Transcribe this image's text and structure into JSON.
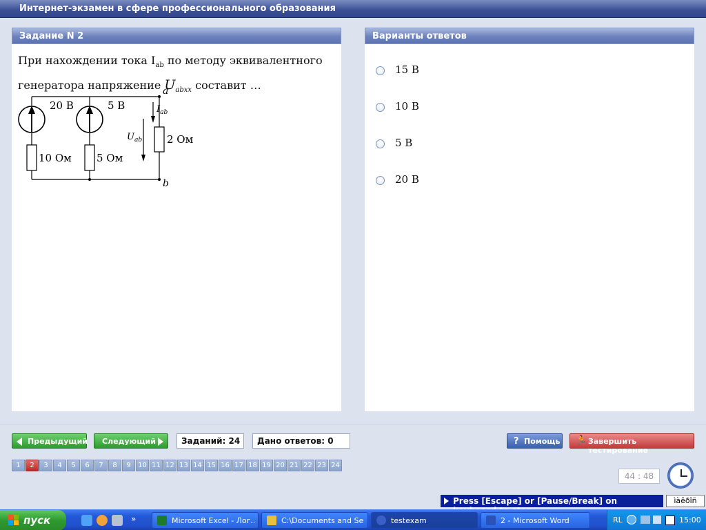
{
  "app": {
    "title": "Интернет-экзамен в сфере профессионального образования"
  },
  "question": {
    "header": "Задание N 2",
    "text_a": "При нахождении тока I",
    "text_sub": "ab",
    "text_b": " по методу эквивалентного",
    "text_c": "генератора напряжение ",
    "text_var": "U",
    "text_var_sub": "abxx",
    "text_d": " составит …",
    "circuit": {
      "src1": "20 В",
      "src2": "5 В",
      "r1": "10 Ом",
      "r2": "5 Ом",
      "r3": "2 Ом",
      "node_a": "a",
      "node_b": "b",
      "i_label": "I",
      "i_sub": "ab",
      "u_label": "U",
      "u_sub": "ab"
    }
  },
  "answers": {
    "header": "Варианты ответов",
    "items": [
      "15 В",
      "10 В",
      "5 В",
      "20 В"
    ]
  },
  "nav": {
    "prev": "Предыдущий",
    "next": "Следующий",
    "tasks_count": "Заданий: 24",
    "answers_given": "Дано ответов: 0",
    "help": "Помощь",
    "finish": "Завершить тестирование",
    "pages": [
      "1",
      "2",
      "3",
      "4",
      "5",
      "6",
      "7",
      "8",
      "9",
      "10",
      "11",
      "12",
      "13",
      "14",
      "15",
      "16",
      "17",
      "18",
      "19",
      "20",
      "21",
      "22",
      "23",
      "24"
    ],
    "current_page": 2,
    "timer": "44 : 48"
  },
  "overlay": {
    "press_stop": "Press [Escape] or [Pause/Break] on keyboard to stop",
    "lang_indicator": "ìàêðîñ"
  },
  "taskbar": {
    "start": "пуск",
    "tasks": [
      {
        "label": "Microsoft Excel - Лог...",
        "icon_color": "#1e7b2e"
      },
      {
        "label": "C:\\Documents and Se...",
        "icon_color": "#e8c040"
      },
      {
        "label": "testexam",
        "icon_color": "#3a5fc8"
      },
      {
        "label": "2 - Microsoft Word",
        "icon_color": "#2a52b8"
      }
    ],
    "tray_lang": "RL",
    "time": "15:00"
  },
  "colors": {
    "accent_blue": "#5c73b2",
    "green_button": "#2e9a2e",
    "red_button": "#c33b3b",
    "active_page": "#c02a2a"
  }
}
